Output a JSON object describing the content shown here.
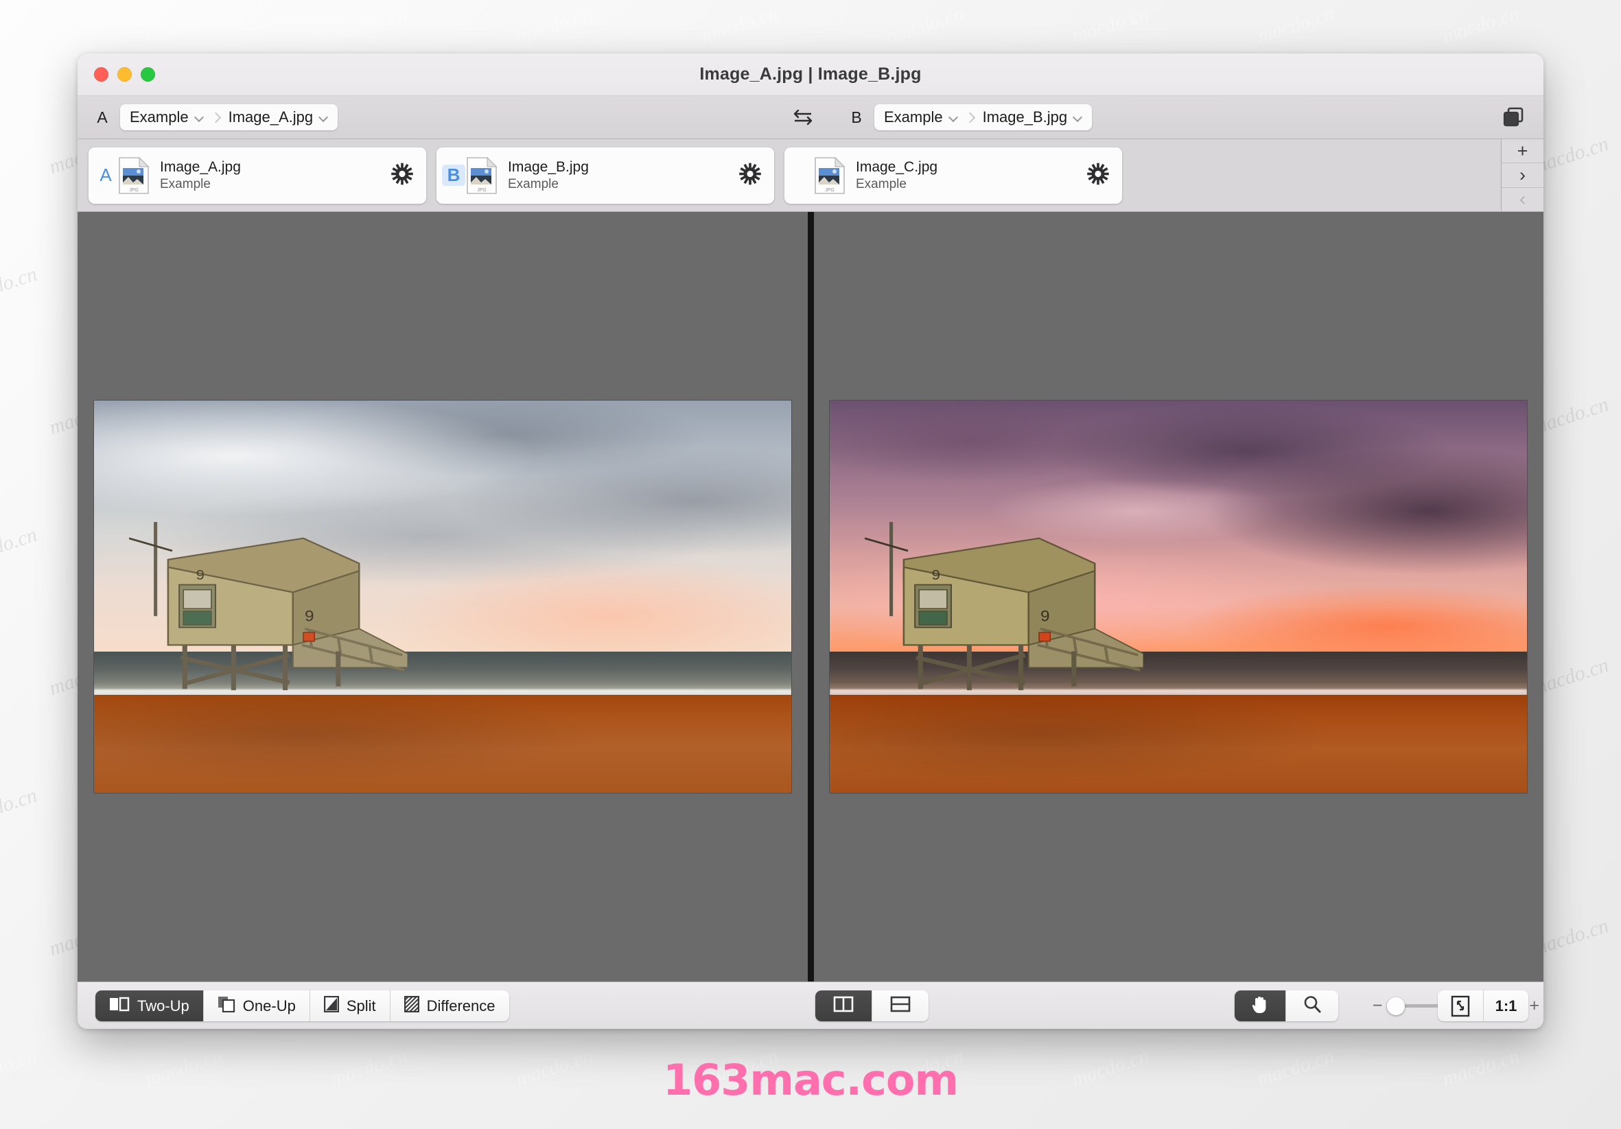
{
  "window": {
    "title": "Image_A.jpg | Image_B.jpg",
    "traffic_lights": [
      "close-red",
      "minimize-yellow",
      "zoom-green"
    ]
  },
  "toolbar": {
    "slot_a": {
      "label": "A",
      "folder": "Example",
      "file": "Image_A.jpg"
    },
    "slot_b": {
      "label": "B",
      "folder": "Example",
      "file": "Image_B.jpg"
    },
    "swap_icon": "swap-arrows-icon",
    "copy_icon": "duplicate-windows-icon"
  },
  "filmstrip": {
    "cards": [
      {
        "badge": "A",
        "badge_state": "assigned",
        "name": "Image_A.jpg",
        "folder": "Example",
        "action_icon": "gear-icon"
      },
      {
        "badge": "B",
        "badge_state": "selected",
        "name": "Image_B.jpg",
        "folder": "Example",
        "action_icon": "gear-icon"
      },
      {
        "badge": "",
        "badge_state": "none",
        "name": "Image_C.jpg",
        "folder": "Example",
        "action_icon": "gear-icon"
      }
    ],
    "side_buttons": [
      {
        "icon": "plus-icon",
        "glyph": "+",
        "state": "enabled"
      },
      {
        "icon": "chevron-right-icon",
        "glyph": "›",
        "state": "enabled"
      },
      {
        "icon": "chevron-left-icon",
        "glyph": "‹",
        "state": "disabled"
      }
    ]
  },
  "viewer": {
    "background_color": "#6b6b6b",
    "divider_color": "#151515",
    "panes": [
      {
        "slot": "A",
        "file": "Image_A.jpg",
        "description": "Lifeguard tower 9 on a beach at dusk, muted grey overcast sky"
      },
      {
        "slot": "B",
        "file": "Image_B.jpg",
        "description": "Same lifeguard tower with dramatic purple and magenta sunset sky"
      }
    ]
  },
  "bottombar": {
    "view_modes": [
      {
        "label": "Two-Up",
        "icon": "two-up-icon",
        "active": true
      },
      {
        "label": "One-Up",
        "icon": "one-up-icon",
        "active": false
      },
      {
        "label": "Split",
        "icon": "split-icon",
        "active": false
      },
      {
        "label": "Difference",
        "icon": "difference-icon",
        "active": false
      }
    ],
    "orientations": [
      {
        "icon": "split-vertical-icon",
        "active": true
      },
      {
        "icon": "split-horizontal-icon",
        "active": false
      }
    ],
    "tools": [
      {
        "icon": "hand-tool-icon",
        "active": true
      },
      {
        "icon": "magnifier-tool-icon",
        "active": false
      }
    ],
    "zoom": {
      "minus": "−",
      "plus": "+",
      "slider_position_percent": 2
    },
    "right_buttons": [
      {
        "icon": "fit-to-window-icon",
        "label": ""
      },
      {
        "icon": "",
        "label": "1:1"
      }
    ]
  },
  "watermarks": {
    "tile_text": "macdo.cn",
    "brand": "163mac.com",
    "brand_color": "#ff6fae"
  }
}
